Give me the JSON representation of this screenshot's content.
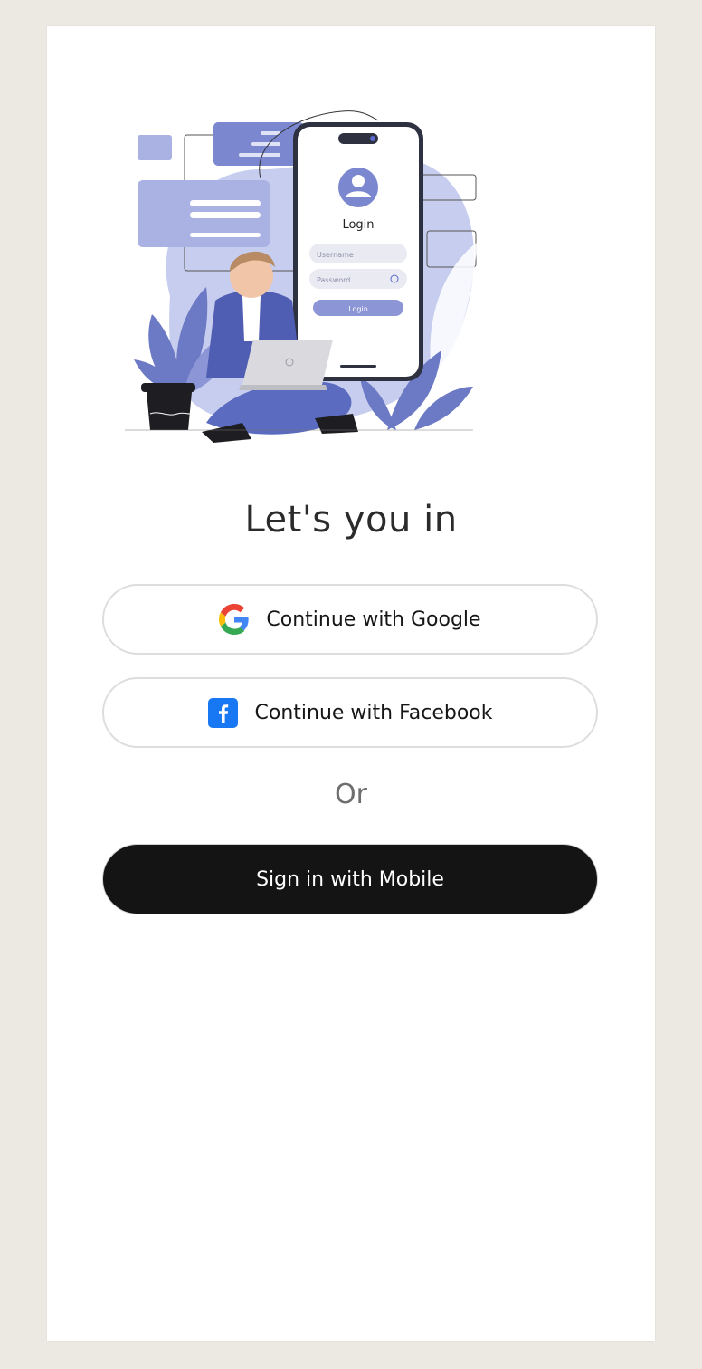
{
  "illustration": {
    "phone_screen_title": "Login",
    "username_placeholder": "Username",
    "password_placeholder": "Password",
    "login_button_label": "Login"
  },
  "heading": "Let's you in",
  "google_button": {
    "label": "Continue with Google",
    "icon": "google-icon"
  },
  "facebook_button": {
    "label": "Continue with Facebook",
    "icon": "facebook-icon"
  },
  "divider_text": "Or",
  "mobile_button": {
    "label": "Sign in with Mobile"
  },
  "colors": {
    "background": "#ece9e3",
    "accent": "#7b87cf",
    "primary_button": "#141414",
    "facebook_blue": "#1877f2"
  }
}
